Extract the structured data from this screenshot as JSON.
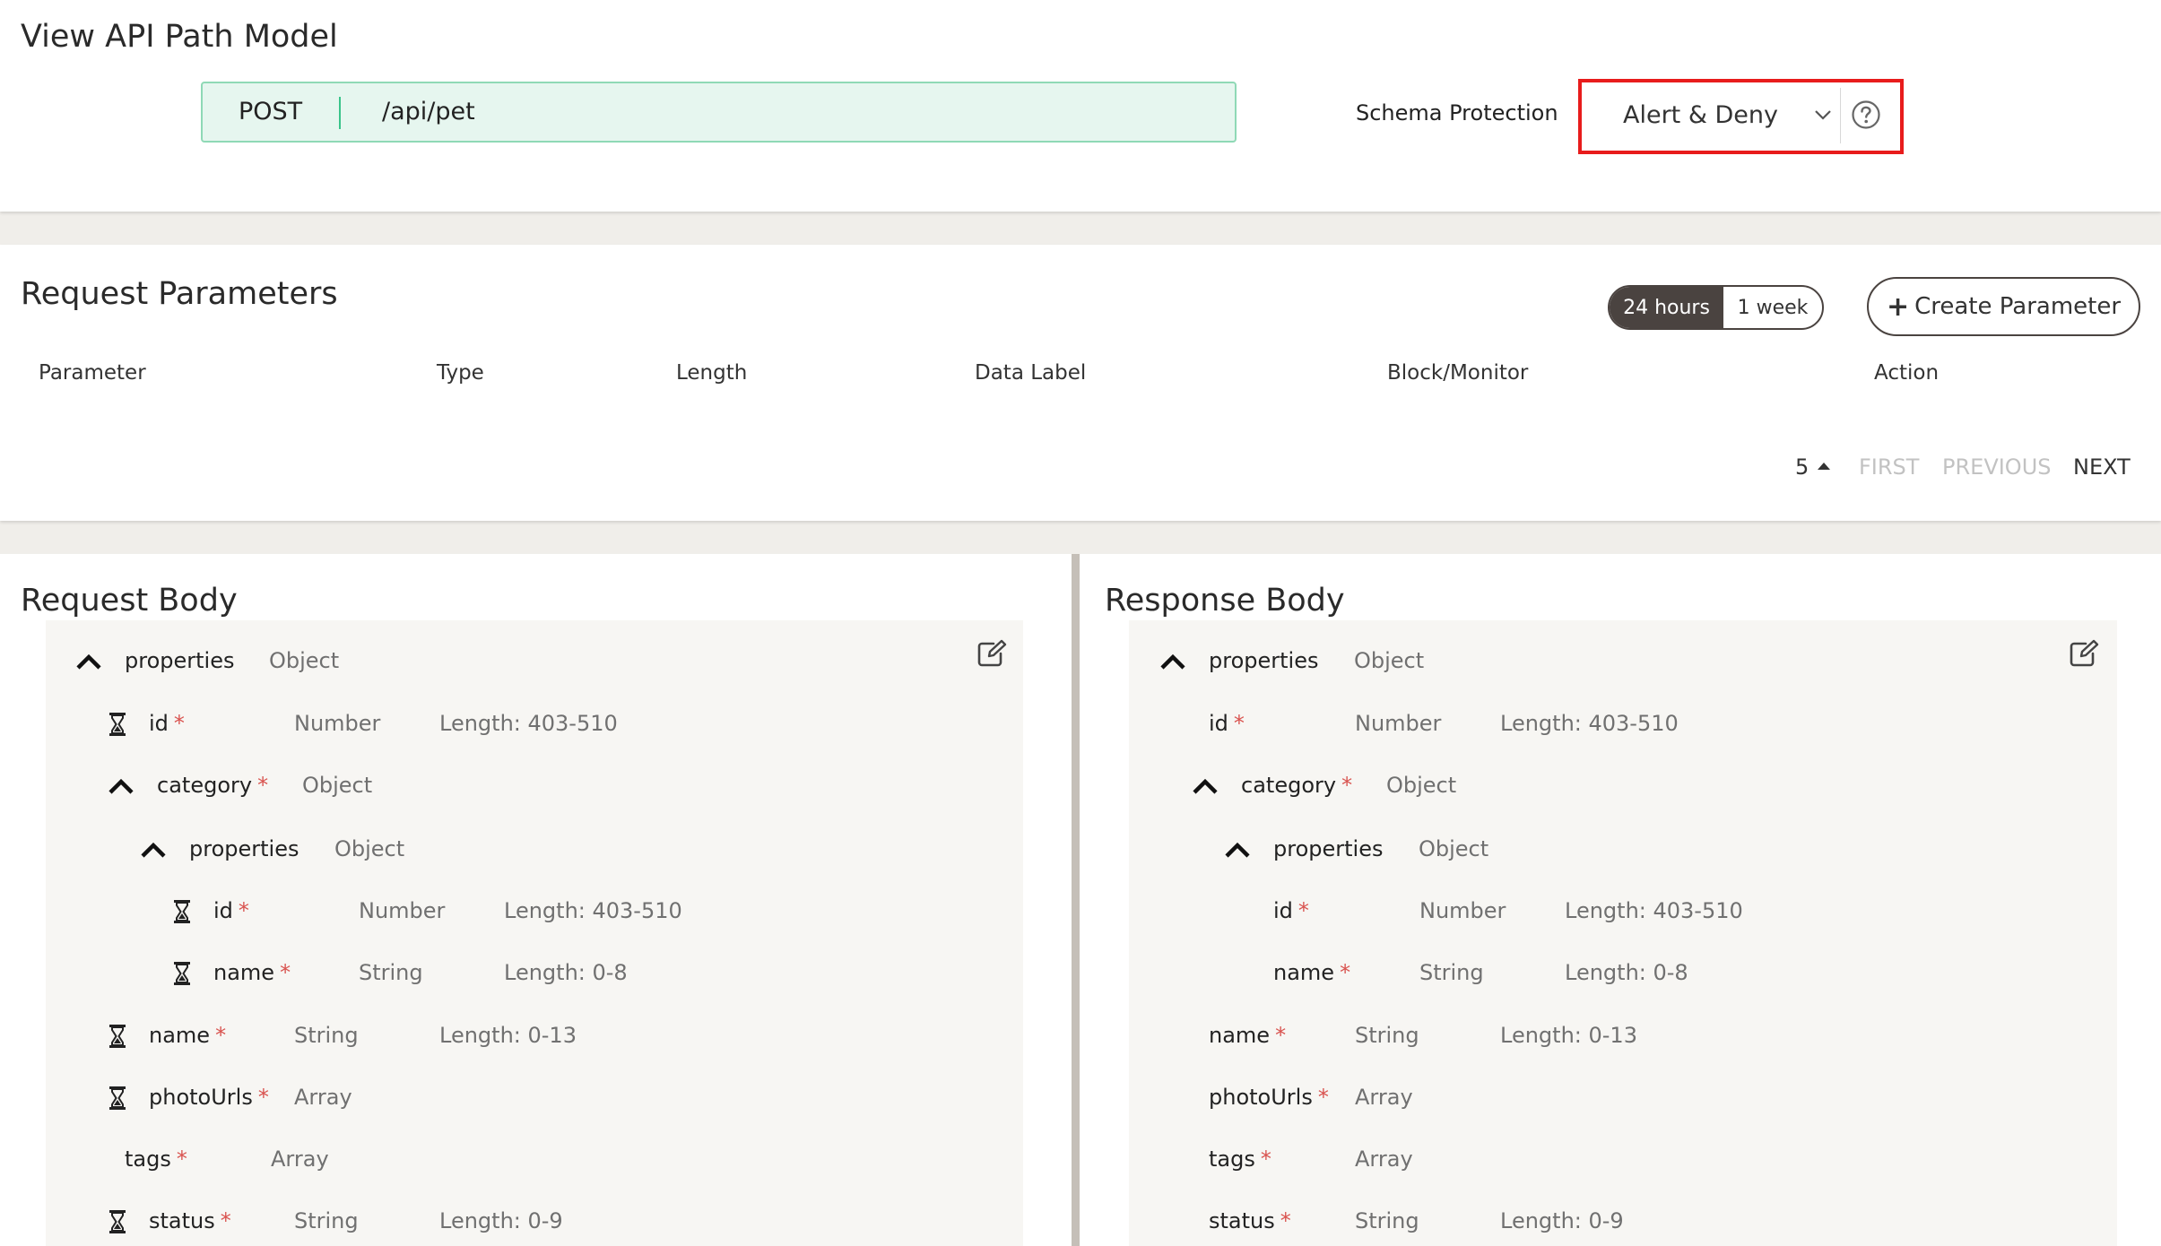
{
  "header": {
    "title": "View API Path Model",
    "method": "POST",
    "path": "/api/pet",
    "schema_protection_label": "Schema Protection",
    "schema_protection_value": "Alert & Deny"
  },
  "request_parameters": {
    "title": "Request Parameters",
    "range_options": [
      "24 hours",
      "1 week"
    ],
    "selected_range": "24 hours",
    "create_button_label": "Create Parameter",
    "columns": [
      "Parameter",
      "Type",
      "Length",
      "Data Label",
      "Block/Monitor",
      "Action"
    ],
    "pagination": {
      "page_size": "5",
      "first": "FIRST",
      "previous": "PREVIOUS",
      "next": "NEXT"
    }
  },
  "request_body": {
    "title": "Request Body",
    "rows": [
      {
        "name": "properties",
        "required": false,
        "type": "Object",
        "length": "",
        "expanded": true,
        "hourglass": false
      },
      {
        "name": "id",
        "required": true,
        "type": "Number",
        "length": "Length: 403-510",
        "hourglass": true
      },
      {
        "name": "category",
        "required": true,
        "type": "Object",
        "length": "",
        "expanded": true,
        "hourglass": false
      },
      {
        "name": "properties",
        "required": false,
        "type": "Object",
        "length": "",
        "expanded": true,
        "hourglass": false
      },
      {
        "name": "id",
        "required": true,
        "type": "Number",
        "length": "Length: 403-510",
        "hourglass": true
      },
      {
        "name": "name",
        "required": true,
        "type": "String",
        "length": "Length: 0-8",
        "hourglass": true
      },
      {
        "name": "name",
        "required": true,
        "type": "String",
        "length": "Length: 0-13",
        "hourglass": true
      },
      {
        "name": "photoUrls",
        "required": true,
        "type": "Array",
        "length": "",
        "hourglass": true
      },
      {
        "name": "tags",
        "required": true,
        "type": "Array",
        "length": "",
        "hourglass": false
      },
      {
        "name": "status",
        "required": true,
        "type": "String",
        "length": "Length: 0-9",
        "hourglass": true
      }
    ]
  },
  "response_body": {
    "title": "Response Body",
    "rows": [
      {
        "name": "properties",
        "required": false,
        "type": "Object",
        "length": "",
        "expanded": true
      },
      {
        "name": "id",
        "required": true,
        "type": "Number",
        "length": "Length: 403-510"
      },
      {
        "name": "category",
        "required": true,
        "type": "Object",
        "length": "",
        "expanded": true
      },
      {
        "name": "properties",
        "required": false,
        "type": "Object",
        "length": "",
        "expanded": true
      },
      {
        "name": "id",
        "required": true,
        "type": "Number",
        "length": "Length: 403-510"
      },
      {
        "name": "name",
        "required": true,
        "type": "String",
        "length": "Length: 0-8"
      },
      {
        "name": "name",
        "required": true,
        "type": "String",
        "length": "Length: 0-13"
      },
      {
        "name": "photoUrls",
        "required": true,
        "type": "Array",
        "length": ""
      },
      {
        "name": "tags",
        "required": true,
        "type": "Array",
        "length": ""
      },
      {
        "name": "status",
        "required": true,
        "type": "String",
        "length": "Length: 0-9"
      }
    ]
  },
  "icons": {
    "chevron": "chevron-down-icon",
    "help": "help-circle-icon",
    "plus": "plus-icon",
    "sort": "caret-up-icon",
    "expand": "chevron-up-icon",
    "hourglass": "hourglass-icon",
    "edit": "edit-icon"
  },
  "colors": {
    "path_bg": "#e6f6ef",
    "path_border": "#8fd9b6",
    "highlight": "#e81c1c",
    "toggle_active": "#4a4340",
    "required": "#d9534f"
  }
}
